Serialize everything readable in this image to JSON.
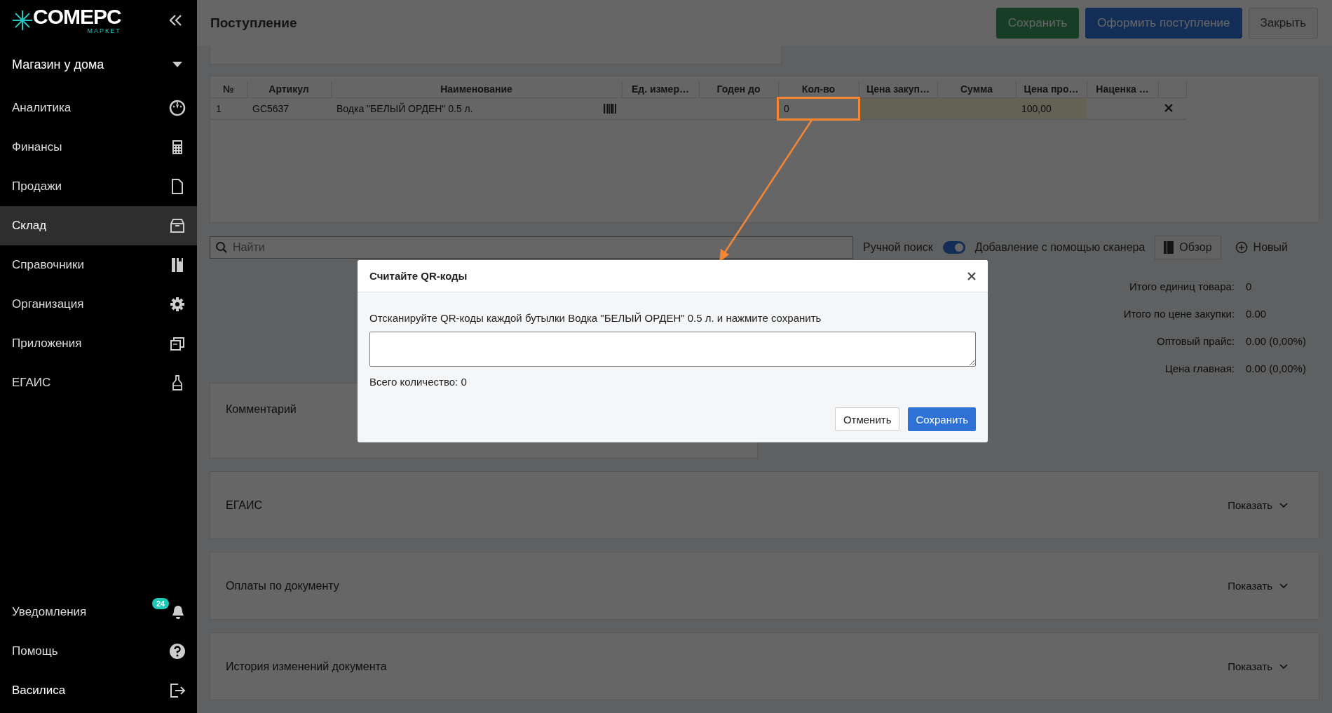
{
  "sidebar": {
    "logo": {
      "name": "COMEPC",
      "sub": "МАРКЕТ"
    },
    "store": "Магазин у дома",
    "items": [
      {
        "label": "Аналитика",
        "selected": false
      },
      {
        "label": "Финансы",
        "selected": false
      },
      {
        "label": "Продажи",
        "selected": false
      },
      {
        "label": "Склад",
        "selected": true
      },
      {
        "label": "Справочники",
        "selected": false
      },
      {
        "label": "Организация",
        "selected": false
      },
      {
        "label": "Приложения",
        "selected": false
      },
      {
        "label": "ЕГАИС",
        "selected": false
      }
    ],
    "notifications": {
      "label": "Уведомления",
      "badge": "24"
    },
    "help": "Помощь",
    "user": "Василиса"
  },
  "header": {
    "title": "Поступление",
    "buttons": [
      {
        "label": "Сохранить",
        "kind": "success"
      },
      {
        "label": "Оформить поступление",
        "kind": "primary"
      },
      {
        "label": "Закрыть",
        "kind": "default"
      }
    ]
  },
  "table": {
    "columns": [
      {
        "label": "№",
        "highlighted": false,
        "annotated": false
      },
      {
        "label": "Артикул",
        "highlighted": false,
        "annotated": false
      },
      {
        "label": "Наименование",
        "highlighted": false,
        "annotated": false
      },
      {
        "label": "Ед. измер…",
        "highlighted": false,
        "annotated": false
      },
      {
        "label": "Годен до",
        "highlighted": false,
        "annotated": false
      },
      {
        "label": "Кол-во",
        "highlighted": false,
        "annotated": true
      },
      {
        "label": "Цена закуп…",
        "highlighted": true,
        "annotated": false
      },
      {
        "label": "Сумма",
        "highlighted": true,
        "annotated": false
      },
      {
        "label": "Цена про…",
        "highlighted": true,
        "annotated": false
      },
      {
        "label": "Наценка …",
        "highlighted": false,
        "annotated": false
      }
    ],
    "rows": [
      {
        "cells": [
          "1",
          "GC5637",
          "Водка \"БЕЛЫЙ ОРДЕН\" 0.5 л.",
          "",
          "",
          "0",
          "",
          "",
          "100,00",
          ""
        ]
      }
    ]
  },
  "search": {
    "placeholder": "Найти"
  },
  "manual_search": {
    "label": "Ручной поиск",
    "on": true
  },
  "scanner_label": "Добавление с помощью сканера",
  "browse_button": "Обзор",
  "new_button": "Новый",
  "totals": [
    {
      "label": "Итого единиц товара:",
      "value": "0"
    },
    {
      "label": "Итого по цене закупки:",
      "value": "0.00"
    },
    {
      "label": "Оптовый прайс:",
      "value": "0.00 (0,00%)"
    },
    {
      "label": "Цена главная:",
      "value": "0.00 (0,00%)"
    }
  ],
  "comment": {
    "label": "Комментарий"
  },
  "sections": [
    {
      "title": "ЕГАИС",
      "toggle": "Показать"
    },
    {
      "title": "Оплаты по документу",
      "toggle": "Показать"
    },
    {
      "title": "История изменений документа",
      "toggle": "Показать"
    }
  ],
  "dialog": {
    "title": "Считайте QR-коды",
    "message": "Отсканируйте QR-коды каждой бутылки Водка \"БЕЛЫЙ ОРДЕН\" 0.5 л. и нажмите сохранить",
    "total": "Всего количество: 0",
    "cancel": "Отменить",
    "save": "Сохранить"
  }
}
